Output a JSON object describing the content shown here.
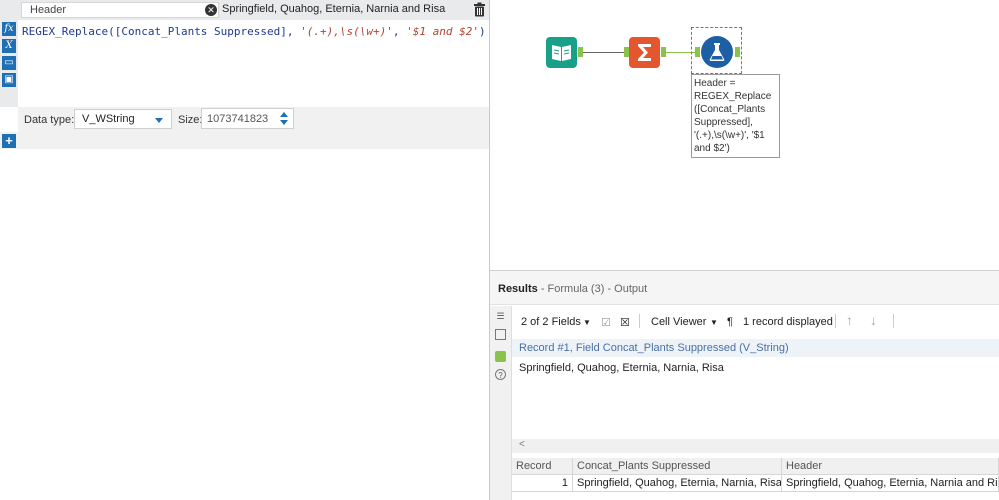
{
  "formula": {
    "output_field": "Header",
    "preview_value": "Springfield, Quahog, Eternia, Narnia and Risa",
    "expression_prefix": "REGEX_Replace(",
    "expression_field": "[Concat_Plants Suppressed]",
    "expression_sep1": ", ",
    "expression_str1": "'(.+),\\s(\\w+)'",
    "expression_sep2": ", ",
    "expression_str2": "'$1 and $2'",
    "expression_suffix": ")",
    "side_icons": [
      "fx-icon",
      "variable-icon",
      "open-folder-icon",
      "save-icon"
    ],
    "data_type_label": "Data type:",
    "data_type_value": "V_WString",
    "size_label": "Size:",
    "size_value": "1073741823"
  },
  "canvas": {
    "annotation": "Header =\nREGEX_Replace\n([Concat_Plants\nSuppressed],\n'(.+),\\s(\\w+)', '$1\nand $2')"
  },
  "results": {
    "title": "Results",
    "subtitle": "- Formula (3) - Output",
    "fields_label": "2 of 2 Fields",
    "cell_viewer_label": "Cell Viewer",
    "pilcrow": "¶",
    "records_label": "1 record displayed",
    "record_header": "Record #1, Field Concat_Plants Suppressed (V_String)",
    "record_value": "Springfield, Quahog, Eternia, Narnia, Risa",
    "scroll_left": "<",
    "columns": [
      "Record",
      "Concat_Plants Suppressed",
      "Header"
    ],
    "rows": [
      [
        "1",
        "Springfield, Quahog, Eternia, Narnia, Risa",
        "Springfield, Quahog, Eternia, Narnia and Risa"
      ]
    ]
  },
  "colors": {
    "accent": "#1f6fb5",
    "input_tool": "#19a089",
    "summarize_tool": "#e4572e",
    "formula_tool": "#1d5fa5",
    "anchor": "#8bc34a"
  }
}
